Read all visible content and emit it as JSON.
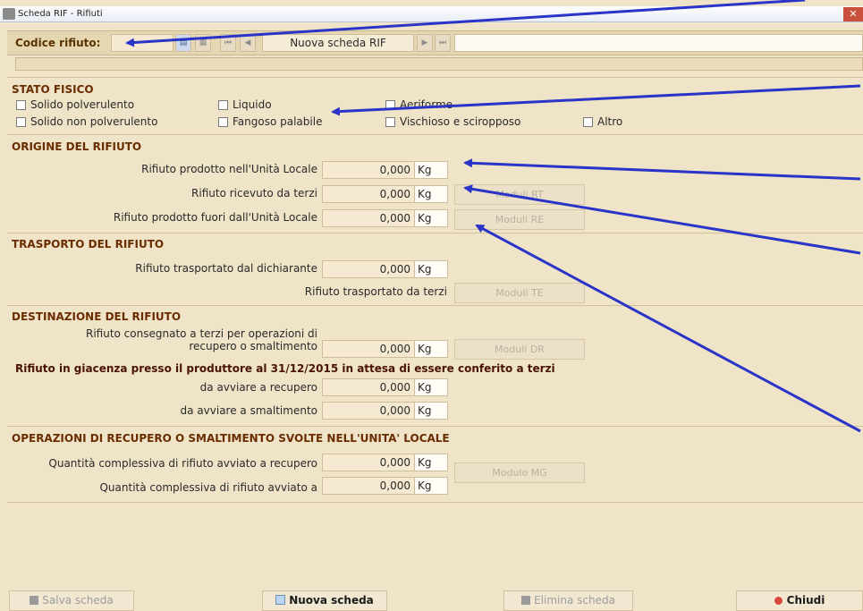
{
  "window": {
    "title": "Scheda RIF - Rifiuti",
    "close_glyph": "✕"
  },
  "toolbar": {
    "code_label": "Codice rifiuto:",
    "code_value": "",
    "nav_title": "Nuova scheda RIF",
    "icons": [
      "save-icon",
      "grid-icon",
      "first-record-icon",
      "prev-record-icon",
      "next-record-icon",
      "last-record-icon"
    ]
  },
  "stato_fisico": {
    "title": "STATO FISICO",
    "options": [
      "Solido polverulento",
      "Liquido",
      "Aeriforme",
      "Solido non polverulento",
      "Fangoso palabile",
      "Vischioso e sciropposo",
      "Altro"
    ]
  },
  "origine": {
    "title": "ORIGINE DEL RIFIUTO",
    "rows": [
      {
        "label": "Rifiuto prodotto nell'Unità Locale",
        "value": "0,000",
        "unit": "Kg"
      },
      {
        "label": "Rifiuto ricevuto da terzi",
        "value": "0,000",
        "unit": "Kg",
        "button": "Moduli RT"
      },
      {
        "label": "Rifiuto prodotto fuori dall'Unità Locale",
        "value": "0,000",
        "unit": "Kg",
        "button": "Moduli RE"
      }
    ]
  },
  "trasporto": {
    "title": "TRASPORTO DEL RIFIUTO",
    "rows": [
      {
        "label": "Rifiuto trasportato dal dichiarante",
        "value": "0,000",
        "unit": "Kg"
      },
      {
        "label": "Rifiuto trasportato da terzi",
        "button": "Moduli TE"
      }
    ]
  },
  "destinazione": {
    "title": "DESTINAZIONE DEL RIFIUTO",
    "consegnato_line1": "Rifiuto consegnato a terzi per operazioni di",
    "consegnato_line2": "recupero o smaltimento",
    "consegnato_value": "0,000",
    "consegnato_unit": "Kg",
    "consegnato_button": "Moduli DR",
    "giacenza_title": "Rifiuto in giacenza presso il produttore al 31/12/2015 in attesa di essere conferito a terzi",
    "giacenza_rows": [
      {
        "label": "da avviare a recupero",
        "value": "0,000",
        "unit": "Kg"
      },
      {
        "label": "da avviare a smaltimento",
        "value": "0,000",
        "unit": "Kg"
      }
    ]
  },
  "operazioni": {
    "title": "OPERAZIONI DI RECUPERO O SMALTIMENTO SVOLTE NELL'UNITA' LOCALE",
    "rows": [
      {
        "label": "Quantità complessiva di rifiuto avviato a recupero",
        "value": "0,000",
        "unit": "Kg"
      },
      {
        "label": "Quantità complessiva di rifiuto avviato a",
        "value": "0,000",
        "unit": "Kg"
      }
    ],
    "button": "Modulo MG"
  },
  "footer": {
    "save": "Salva scheda",
    "new": "Nuova scheda",
    "delete": "Elimina scheda",
    "close": "Chiudi"
  },
  "colors": {
    "background": "#efe3c8",
    "section_title": "#6a2d00",
    "annotation_arrow": "#2a35c8",
    "close_button": "#c9503c"
  }
}
